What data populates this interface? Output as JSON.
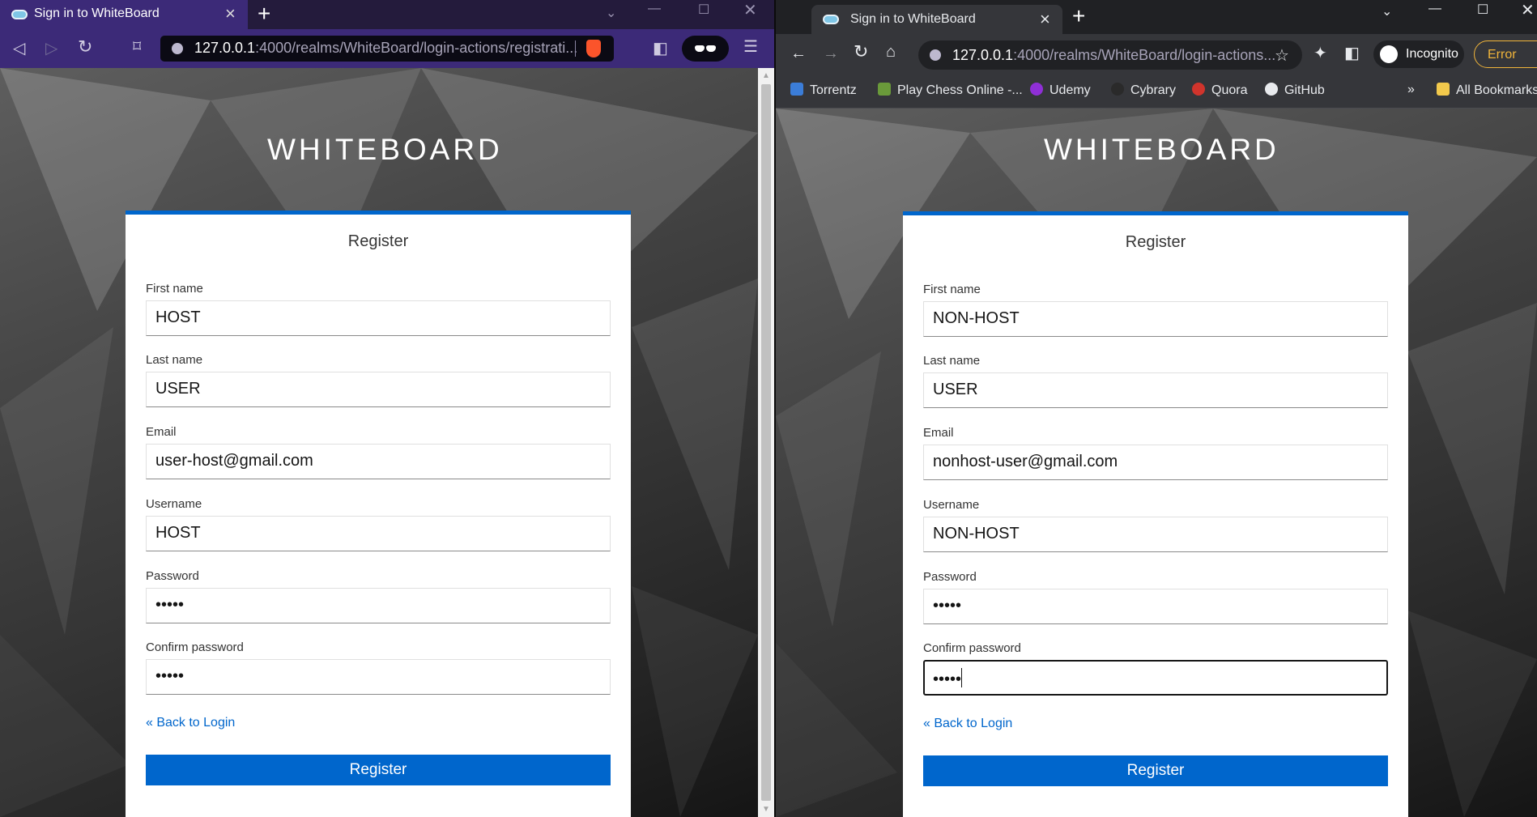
{
  "left_window": {
    "tab_title": "Sign in to WhiteBoard",
    "url_host": "127.0.0.1",
    "url_rest": ":4000/realms/WhiteBoard/login-actions/registrati..."
  },
  "right_window": {
    "tab_title": "Sign in to WhiteBoard",
    "url_host": "127.0.0.1",
    "url_rest": ":4000/realms/WhiteBoard/login-actions...",
    "incognito_label": "Incognito",
    "error_label": "Error",
    "bookmarks": [
      {
        "label": "Torrentz",
        "color": "#3b7dd8"
      },
      {
        "label": "Play Chess Online -...",
        "color": "#6a9a3a"
      },
      {
        "label": "Udemy",
        "color": "#8f2fd6"
      },
      {
        "label": "Cybrary",
        "color": "#2a2a2a"
      },
      {
        "label": "Quora",
        "color": "#d0342c"
      },
      {
        "label": "GitHub",
        "color": "#e8eaed"
      }
    ],
    "bookmarks_overflow": "»",
    "all_bookmarks": "All Bookmarks"
  },
  "form_left": {
    "brand": "WHITEBOARD",
    "title": "Register",
    "first_name_label": "First name",
    "first_name": "HOST",
    "last_name_label": "Last name",
    "last_name": "USER",
    "email_label": "Email",
    "email": "user-host@gmail.com",
    "username_label": "Username",
    "username": "HOST",
    "password_label": "Password",
    "password": "•••••",
    "confirm_label": "Confirm password",
    "confirm": "•••••",
    "back_link": "« Back to Login",
    "submit": "Register"
  },
  "form_right": {
    "brand": "WHITEBOARD",
    "title": "Register",
    "first_name_label": "First name",
    "first_name": "NON-HOST",
    "last_name_label": "Last name",
    "last_name": "USER",
    "email_label": "Email",
    "email": "nonhost-user@gmail.com",
    "username_label": "Username",
    "username": "NON-HOST",
    "password_label": "Password",
    "password": "•••••",
    "confirm_label": "Confirm password",
    "confirm": "•••••",
    "back_link": "« Back to Login",
    "submit": "Register"
  },
  "colors": {
    "accent": "#0066cc",
    "brave_chrome": "#3c2a78",
    "chrome_dark": "#35363a"
  }
}
